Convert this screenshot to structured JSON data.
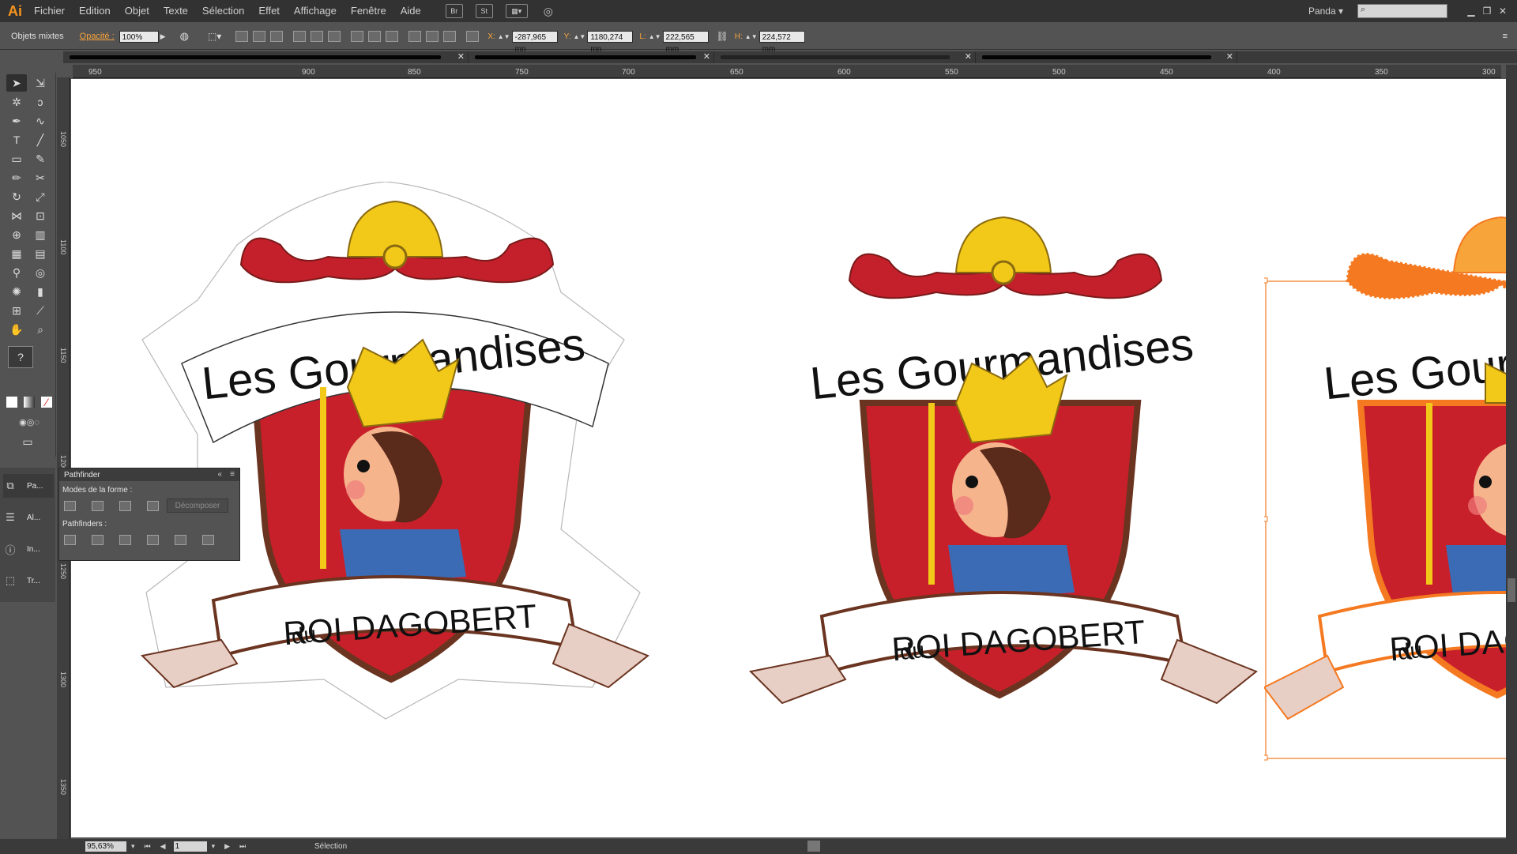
{
  "app": {
    "logo": "Ai",
    "accent": "#f7941d"
  },
  "menu": [
    "Fichier",
    "Edition",
    "Objet",
    "Texte",
    "Sélection",
    "Effet",
    "Affichage",
    "Fenêtre",
    "Aide"
  ],
  "menu_badges": [
    "Br",
    "St"
  ],
  "workspace_user": "Panda",
  "control_bar": {
    "selection_type": "Objets mixtes",
    "opacity_label": "Opacité :",
    "opacity_value": "100%",
    "x_label": "X:",
    "x_value": "-287,965 mn",
    "y_label": "Y:",
    "y_value": "1180,274 mn",
    "w_label": "L:",
    "w_value": "222,565 mm",
    "h_label": "H:",
    "h_value": "224,572 mm"
  },
  "ruler_top": [
    "950",
    "900",
    "850",
    "800",
    "750",
    "700",
    "650",
    "600",
    "550",
    "500",
    "450",
    "400",
    "350",
    "300"
  ],
  "ruler_left": [
    "1050",
    "1100",
    "1150",
    "1200",
    "1250",
    "1300",
    "1350"
  ],
  "pathfinder": {
    "title": "Pathfinder",
    "shape_modes_label": "Modes de la forme :",
    "pathfinders_label": "Pathfinders :",
    "expand_button": "Décomposer"
  },
  "dock": [
    {
      "icon": "pathfinder-icon",
      "label": "Pa..."
    },
    {
      "icon": "align-icon",
      "label": "Al..."
    },
    {
      "icon": "info-icon",
      "label": "In..."
    },
    {
      "icon": "transform-icon",
      "label": "Tr..."
    }
  ],
  "artwork": {
    "line1": "Les Gourmandises",
    "line2_small": "du",
    "line2": "ROI DAGOBERT"
  },
  "statusbar": {
    "zoom": "95,63%",
    "page": "1",
    "status": "Sélection"
  },
  "colors": {
    "shield_red": "#c8202a",
    "crown_gold": "#f2c919",
    "scroll_red": "#c4202b",
    "border_brown": "#6b3420",
    "selection_orange": "#f47920"
  }
}
